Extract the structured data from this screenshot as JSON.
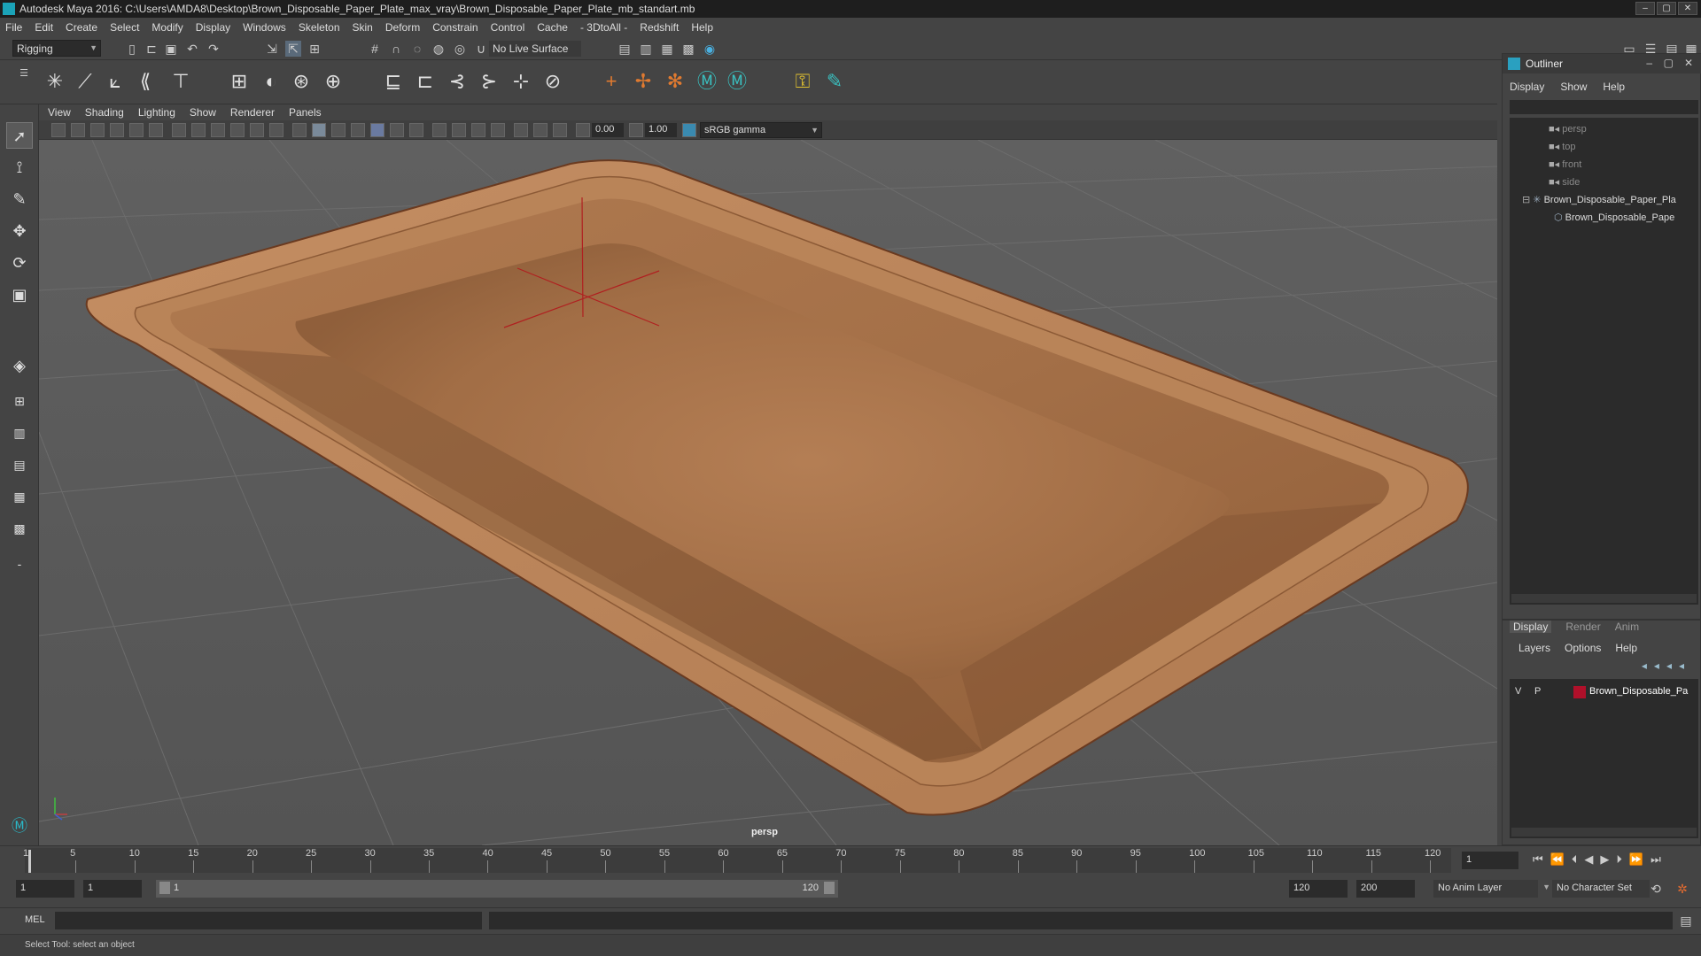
{
  "window": {
    "title": "Autodesk Maya 2016: C:\\Users\\AMDA8\\Desktop\\Brown_Disposable_Paper_Plate_max_vray\\Brown_Disposable_Paper_Plate_mb_standart.mb",
    "buttons": [
      "–",
      "▢",
      "✕"
    ]
  },
  "menubar": [
    "File",
    "Edit",
    "Create",
    "Select",
    "Modify",
    "Display",
    "Windows",
    "Skeleton",
    "Skin",
    "Deform",
    "Constrain",
    "Control",
    "Cache",
    "- 3DtoAll -",
    "Redshift",
    "Help"
  ],
  "statusline": {
    "mode": "Rigging",
    "live_surface": "No Live Surface"
  },
  "panel": {
    "menus": [
      "View",
      "Shading",
      "Lighting",
      "Show",
      "Renderer",
      "Panels"
    ],
    "exposure": "0.00",
    "gamma": "1.00",
    "colorspace": "sRGB gamma",
    "camera": "persp"
  },
  "outliner": {
    "title": "Outliner",
    "menus": [
      "Display",
      "Show",
      "Help"
    ],
    "items": [
      {
        "label": "persp",
        "icon": "camera-icon"
      },
      {
        "label": "top",
        "icon": "camera-icon"
      },
      {
        "label": "front",
        "icon": "camera-icon"
      },
      {
        "label": "side",
        "icon": "camera-icon"
      },
      {
        "label": "Brown_Disposable_Paper_Pla",
        "icon": "group-icon"
      },
      {
        "label": "Brown_Disposable_Pape",
        "icon": "mesh-icon"
      }
    ]
  },
  "layer_editor": {
    "tabs": [
      "Display",
      "Render",
      "Anim"
    ],
    "menus": [
      "Layers",
      "Options",
      "Help"
    ],
    "layer": {
      "v": "V",
      "p": "P",
      "name": "Brown_Disposable_Pa",
      "color": "#b0102a"
    }
  },
  "timeline": {
    "ticks": [
      "1",
      "5",
      "10",
      "15",
      "20",
      "25",
      "30",
      "35",
      "40",
      "45",
      "50",
      "55",
      "60",
      "65",
      "70",
      "75",
      "80",
      "85",
      "90",
      "95",
      "100",
      "105",
      "110",
      "115",
      "120"
    ],
    "current_frame": "1"
  },
  "range": {
    "start": "1",
    "start_inner": "1",
    "slider_start": "1",
    "slider_end": "120",
    "end_inner": "120",
    "end": "200",
    "anim_layer": "No Anim Layer",
    "character_set": "No Character Set"
  },
  "commandline": {
    "label": "MEL"
  },
  "helpline": {
    "text": "Select Tool: select an object"
  }
}
